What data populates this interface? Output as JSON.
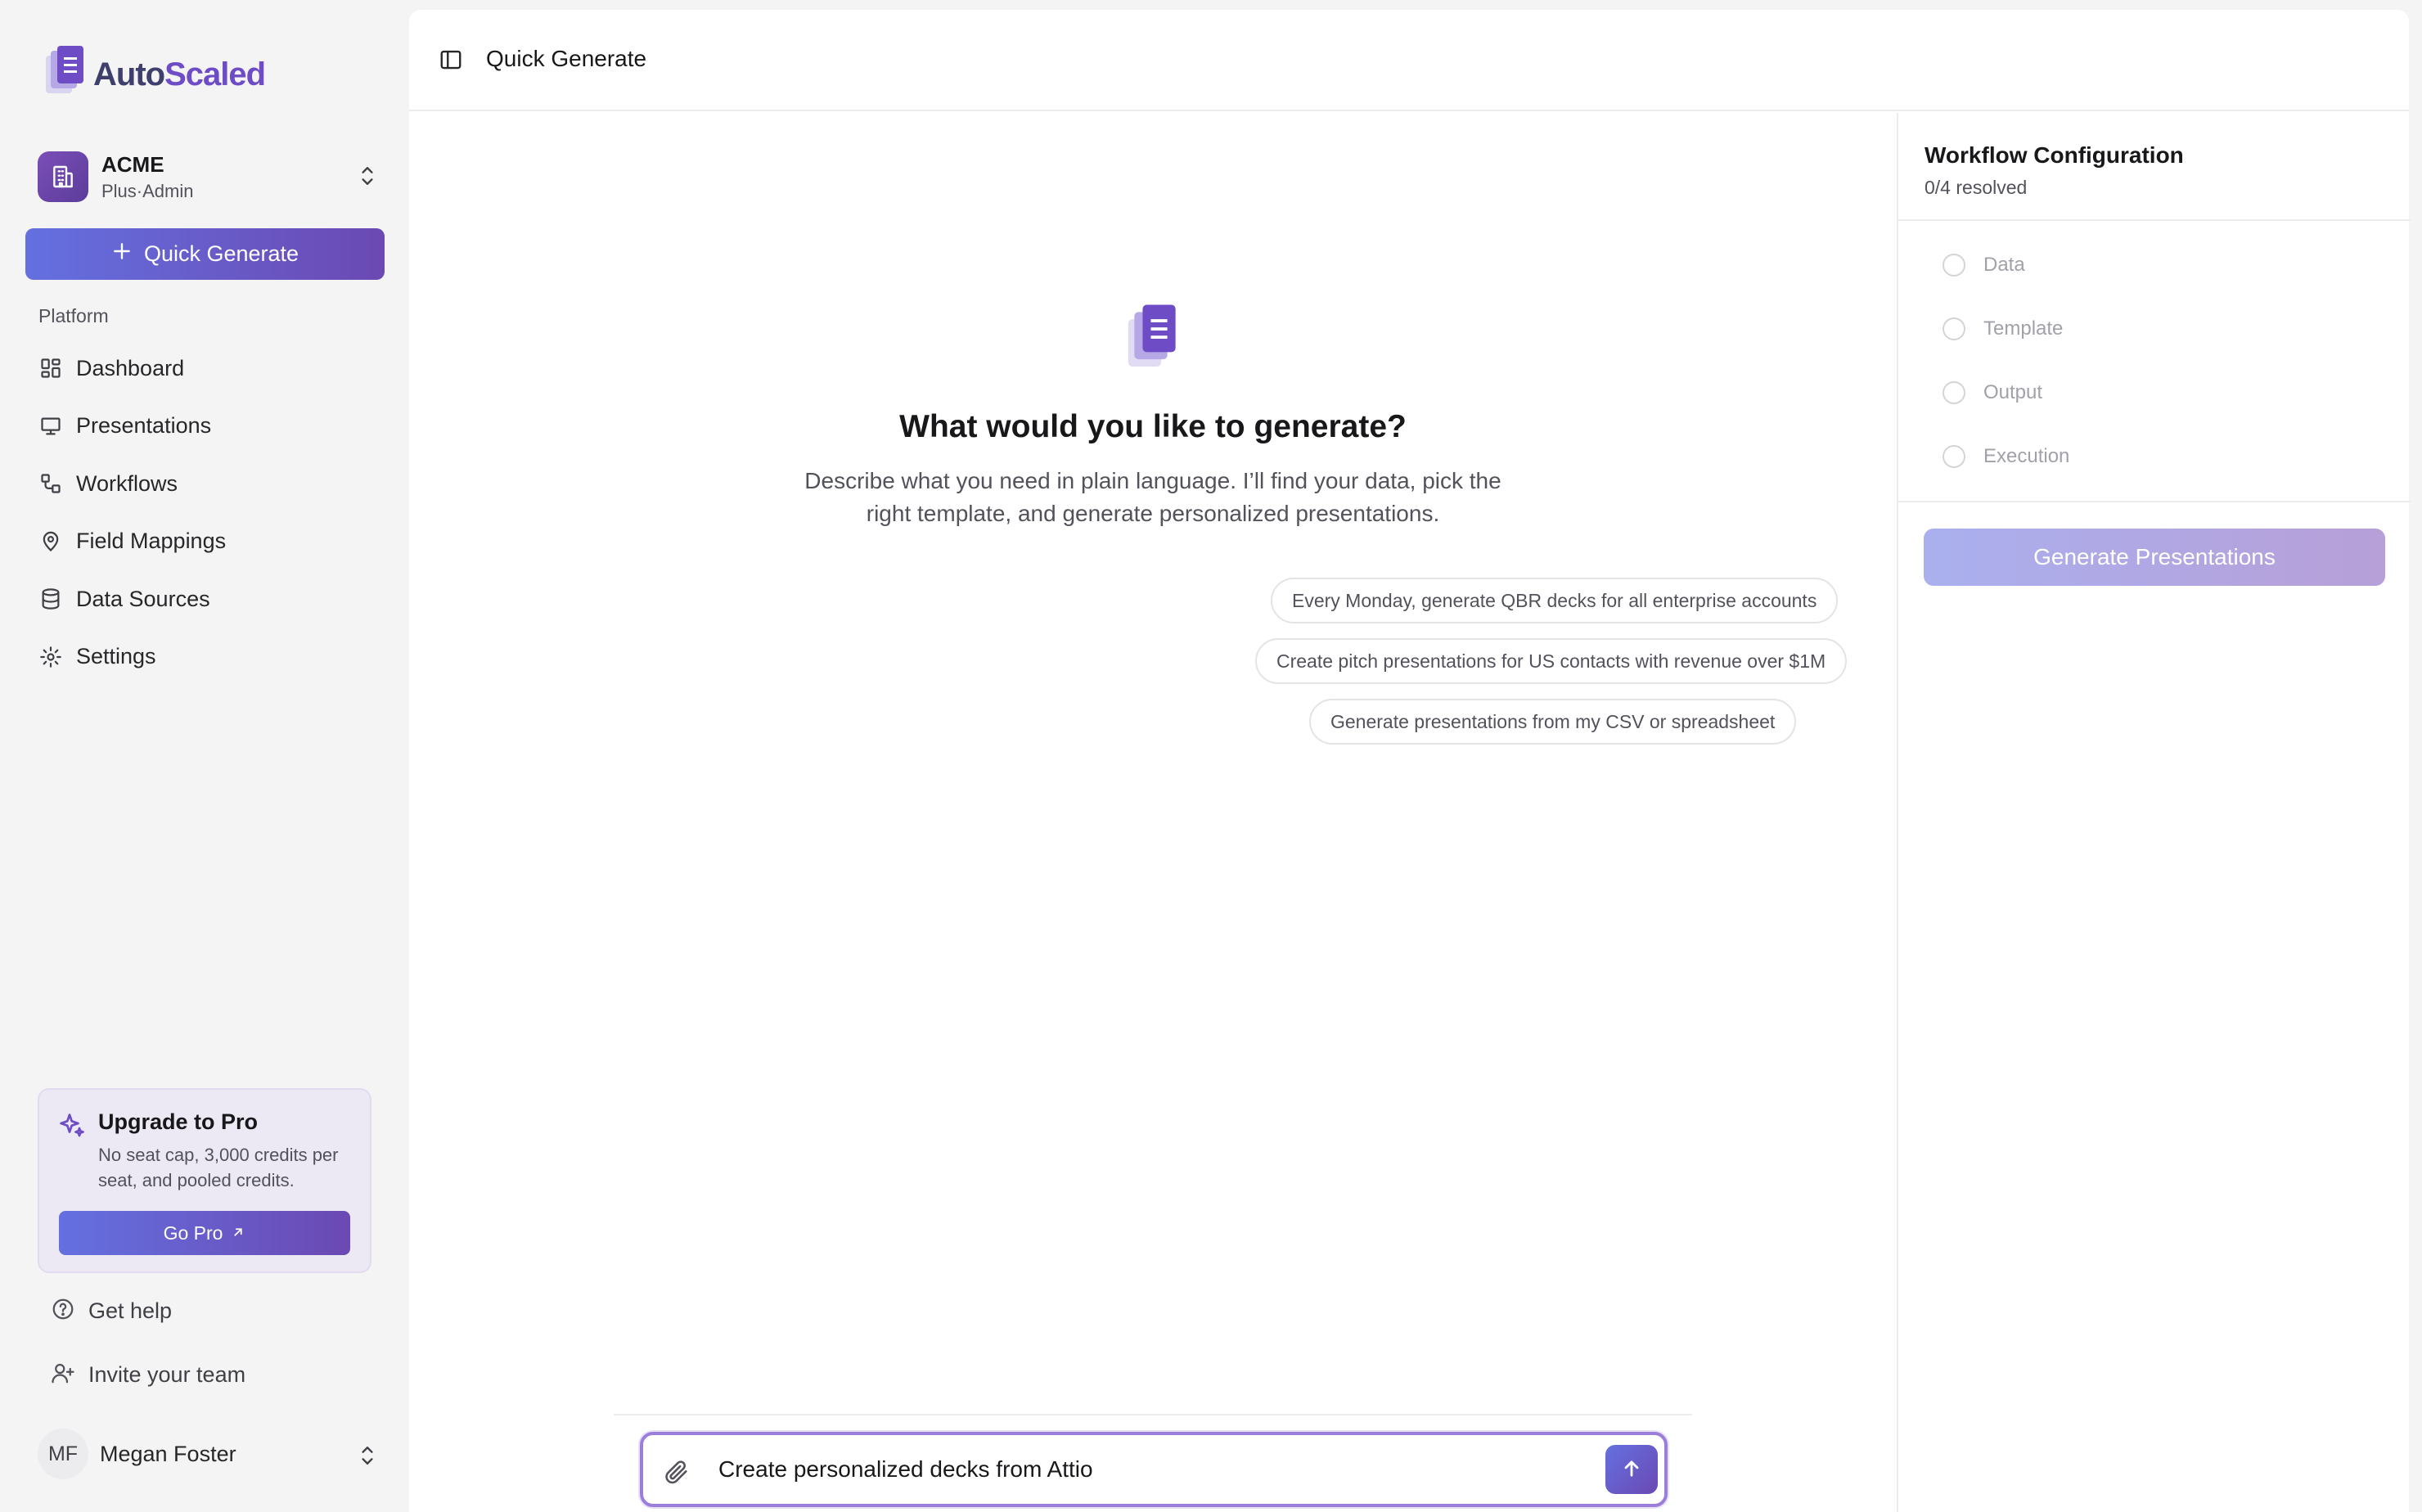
{
  "brand": {
    "name_part1": "Auto",
    "name_part2": "Scaled"
  },
  "org": {
    "name": "ACME",
    "subtitle": "Plus·Admin"
  },
  "sidebar": {
    "quick_generate_label": "Quick Generate",
    "section_label": "Platform",
    "items": [
      {
        "label": "Dashboard",
        "icon": "dashboard-icon"
      },
      {
        "label": "Presentations",
        "icon": "presentation-icon"
      },
      {
        "label": "Workflows",
        "icon": "workflow-icon"
      },
      {
        "label": "Field Mappings",
        "icon": "map-pin-icon"
      },
      {
        "label": "Data Sources",
        "icon": "database-icon"
      },
      {
        "label": "Settings",
        "icon": "gear-icon"
      }
    ],
    "upgrade": {
      "title": "Upgrade to Pro",
      "description": "No seat cap, 3,000 credits per seat, and pooled credits.",
      "button_label": "Go Pro"
    },
    "get_help_label": "Get help",
    "invite_label": "Invite your team",
    "user": {
      "initials": "MF",
      "name": "Megan Foster"
    }
  },
  "header": {
    "title": "Quick Generate"
  },
  "main": {
    "heading": "What would you like to generate?",
    "description": "Describe what you need in plain language. I’ll find your data, pick the right template, and generate personalized presentations.",
    "suggestions": [
      "Every Monday, generate QBR decks for all enterprise accounts",
      "Create pitch presentations for US contacts with revenue over $1M",
      "Generate presentations from my CSV or spreadsheet"
    ],
    "composer_text": "Create personalized decks from Attio"
  },
  "workflow": {
    "title": "Workflow Configuration",
    "status": "0/4 resolved",
    "steps": [
      "Data",
      "Template",
      "Output",
      "Execution"
    ],
    "generate_label": "Generate Presentations"
  },
  "colors": {
    "accent_start": "#6470e0",
    "accent_end": "#6b49b3",
    "composer_border": "#9b7ed9"
  }
}
